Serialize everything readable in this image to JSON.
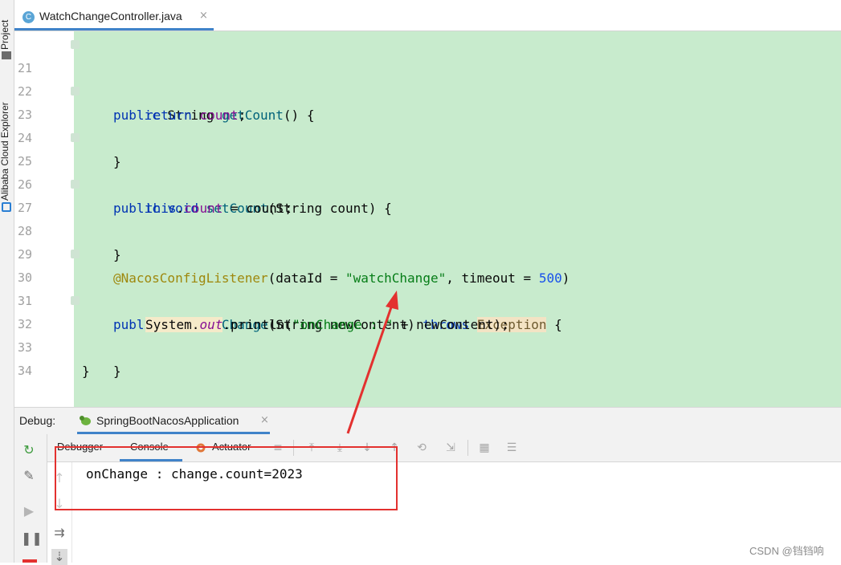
{
  "sidebar": {
    "project_label": "Project",
    "cloud_explorer_label": "Alibaba Cloud Explorer"
  },
  "editor_tab": {
    "icon_letter": "C",
    "file_name": "WatchChangeController.java",
    "close_glyph": "×"
  },
  "editor": {
    "lines": [
      {
        "number": "21"
      },
      {
        "number": "22"
      },
      {
        "number": "23"
      },
      {
        "number": "24"
      },
      {
        "number": "25"
      },
      {
        "number": "26"
      },
      {
        "number": "27"
      },
      {
        "number": "28"
      },
      {
        "number": "29"
      },
      {
        "number": "30"
      },
      {
        "number": "31"
      },
      {
        "number": "32"
      },
      {
        "number": "33"
      },
      {
        "number": "34"
      }
    ],
    "code": {
      "l21_kw": "public",
      "l21_type": " String ",
      "l21_fn": "getCount",
      "l21_rest": "() {",
      "l22_kw": "return",
      "l22_fld": "count",
      "l22_rest": ";",
      "l23": "}",
      "l25_kw": "public void",
      "l25_fn": "setCount",
      "l25_rest": "(String count) {",
      "l26_kw": "this",
      "l26_dot": ".",
      "l26_fld": "count",
      "l26_rest": " = count;",
      "l27": "}",
      "l29_ann": "@NacosConfigListener",
      "l29_a": "(dataId = ",
      "l29_str": "\"watchChange\"",
      "l29_b": ", timeout = ",
      "l29_num": "500",
      "l29_c": ")",
      "l30_kw": "public void",
      "l30_fn": "onChange",
      "l30_a": "(String newContent) ",
      "l30_throws": "throws",
      "l30_exc": "Exception",
      "l30_b": " {",
      "l31_sys": "System.",
      "l31_out": "out",
      "l31_a": ".println(",
      "l31_str": "\"onChange : \"",
      "l31_b": " + newContent);",
      "l32": "}",
      "l33": "}"
    }
  },
  "debug_panel": {
    "label": "Debug:",
    "session_name": "SpringBootNacosApplication",
    "close_glyph": "×",
    "subtabs": {
      "debugger": "Debugger",
      "console": "Console",
      "actuator": "Actuator"
    }
  },
  "console": {
    "output": "onChange : change.count=2023"
  },
  "watermark": "CSDN @铛铛响",
  "colors": {
    "code_bg": "#c8ebcd",
    "keyword": "#0033b3",
    "string": "#067d17",
    "annotation_box": "#e3312f",
    "accent": "#4083c9"
  }
}
